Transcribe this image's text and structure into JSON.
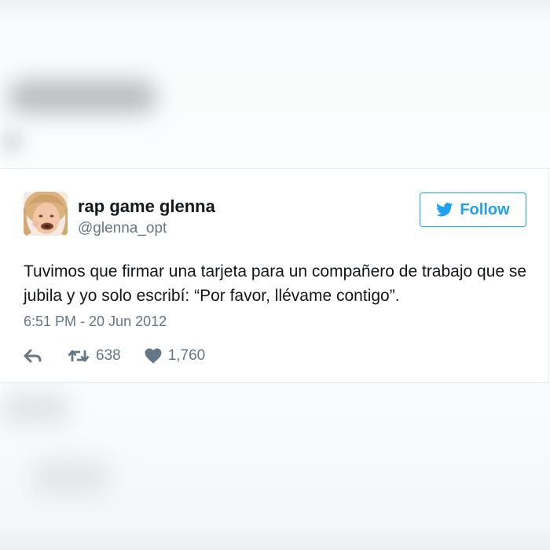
{
  "tweet": {
    "display_name": "rap game glenna",
    "handle": "@glenna_opt",
    "follow_label": "Follow",
    "text": "Tuvimos que firmar una tarjeta para un compañero de trabajo que se jubila y yo solo escribí: “Por favor, llévame contigo”.",
    "timestamp": "6:51 PM - 20 Jun 2012",
    "retweet_count": "638",
    "like_count": "1,760",
    "icons": {
      "follow": "twitter-bird-icon",
      "reply": "reply-icon",
      "retweet": "retweet-icon",
      "like": "heart-icon"
    }
  },
  "colors": {
    "accent": "#1da1f2",
    "text": "#14171a",
    "muted": "#657786"
  }
}
